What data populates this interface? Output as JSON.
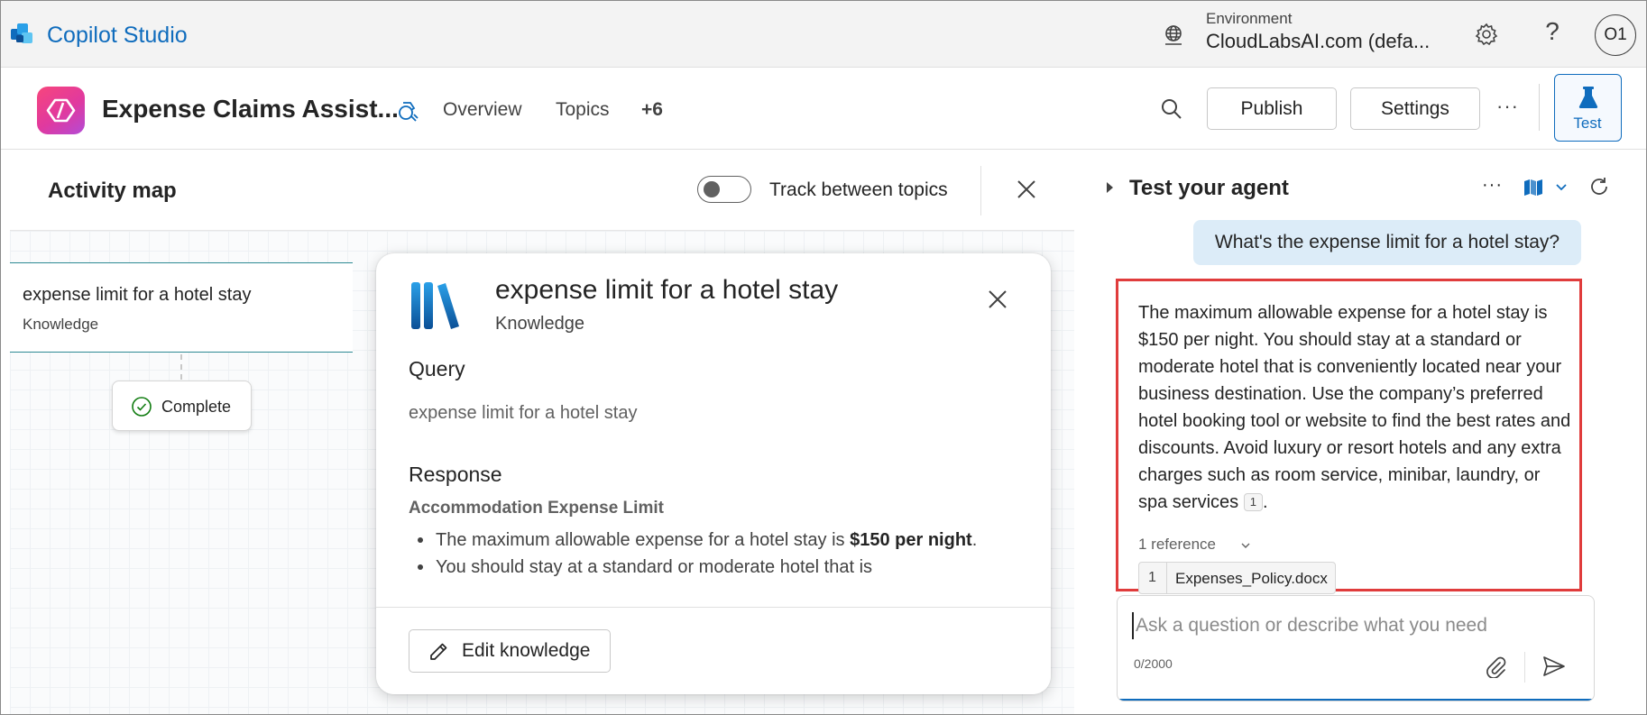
{
  "app": {
    "title": "Copilot Studio"
  },
  "environment": {
    "label": "Environment",
    "value": "CloudLabsAI.com (defa..."
  },
  "user": {
    "initials": "O1"
  },
  "agent": {
    "name": "Expense Claims Assist...",
    "nav": [
      "Overview",
      "Topics",
      "+6"
    ],
    "publish_label": "Publish",
    "settings_label": "Settings",
    "more_label": "···",
    "test_label": "Test"
  },
  "activity_map": {
    "title": "Activity map",
    "toggle_label": "Track between topics",
    "toggle_on": false,
    "node": {
      "title": "expense limit for a hotel stay",
      "type": "Knowledge"
    },
    "status": "Complete"
  },
  "detail": {
    "title": "expense limit for a hotel stay",
    "subtitle": "Knowledge",
    "query_heading": "Query",
    "query_text": "expense limit for a hotel stay",
    "response_heading": "Response",
    "response_subheading": "Accommodation Expense Limit",
    "bullets": [
      {
        "text": "The maximum allowable expense for a hotel stay is ",
        "bold": "$150 per night",
        "tail": "."
      },
      {
        "text": "You should stay at a standard or moderate hotel that is",
        "bold": "",
        "tail": ""
      }
    ],
    "edit_label": "Edit knowledge"
  },
  "test_panel": {
    "title": "Test your agent",
    "more_label": "···",
    "user_message": "What's the expense limit for a hotel stay?",
    "answer": "The maximum allowable expense for a hotel stay is $150 per night. You should stay at a standard or moderate hotel that is conveniently located near your business destination. Use the company’s preferred hotel booking tool or website to find the best rates and discounts. Avoid luxury or resort hotels and any extra charges such as room service, minibar, laundry, or spa services",
    "citation": "1",
    "answer_end": ".",
    "references_label": "1 reference",
    "reference": {
      "num": "1",
      "name": "Expenses_Policy.docx"
    },
    "input_placeholder": "Ask a question or describe what you need",
    "char_count": "0/2000"
  },
  "colors": {
    "brand_blue": "#0f6cbd",
    "highlight_red": "#e03c3c",
    "user_bubble": "#dcecf8",
    "node_border": "#2d8a94",
    "success_green": "#107c10"
  },
  "icons": [
    "copilot-logo-icon",
    "globe-icon",
    "gear-icon",
    "help-icon",
    "agent-icon",
    "agent-edit-icon",
    "search-icon",
    "flask-icon",
    "close-icon",
    "check-circle-icon",
    "books-icon",
    "pencil-icon",
    "map-icon",
    "chevron-down-icon",
    "refresh-icon",
    "attach-icon",
    "send-icon"
  ]
}
